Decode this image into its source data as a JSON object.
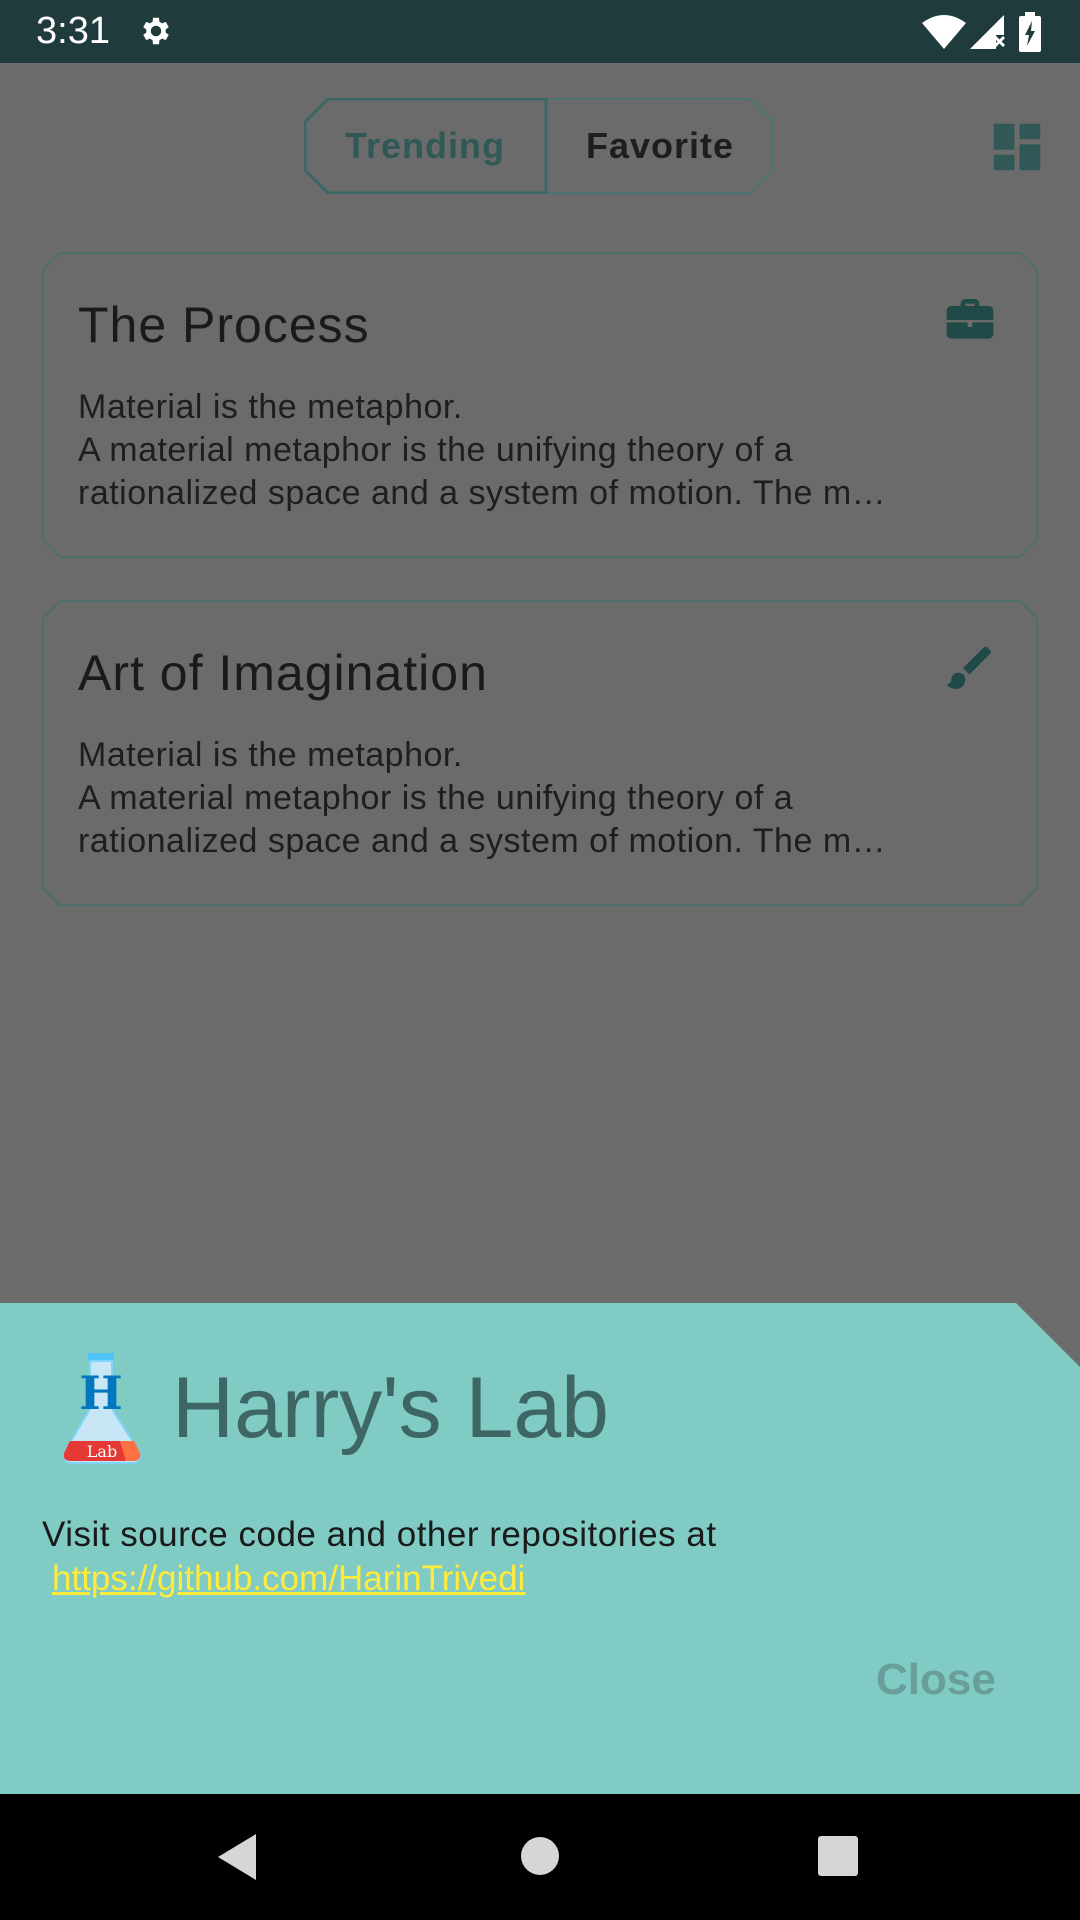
{
  "status_bar": {
    "time": "3:31",
    "icons": [
      "gear-icon",
      "wifi-icon",
      "signal-icon",
      "battery-icon"
    ]
  },
  "tabs": [
    {
      "label": "Trending",
      "selected": true
    },
    {
      "label": "Favorite",
      "selected": false
    }
  ],
  "toolbar": {
    "layout_icon": "dashboard-icon"
  },
  "cards": [
    {
      "title": "The Process",
      "description": "Material is the metaphor.\n A material metaphor is the unifying theory of a\nrationalized space and a system of motion. The m…",
      "icon": "briefcase-icon"
    },
    {
      "title": "Art of Imagination",
      "description": "Material is the metaphor.\n A material metaphor is the unifying theory of a\nrationalized space and a system of motion. The m…",
      "icon": "paintbrush-icon"
    }
  ],
  "sheet": {
    "title": "Harry's Lab",
    "logo_letter": "H",
    "logo_text": "Lab",
    "text": "Visit source code and other repositories at",
    "link": "https://github.com/HarinTrivedi",
    "close_label": "Close"
  },
  "colors": {
    "scrim": "#6b6b6b",
    "status_bar": "#1f3b3b",
    "sheet_bg": "#80cbc4",
    "accent": "#2f5856",
    "link": "#ffeb3b"
  },
  "nav": {
    "icons": [
      "back-icon",
      "home-icon",
      "recents-icon"
    ]
  }
}
